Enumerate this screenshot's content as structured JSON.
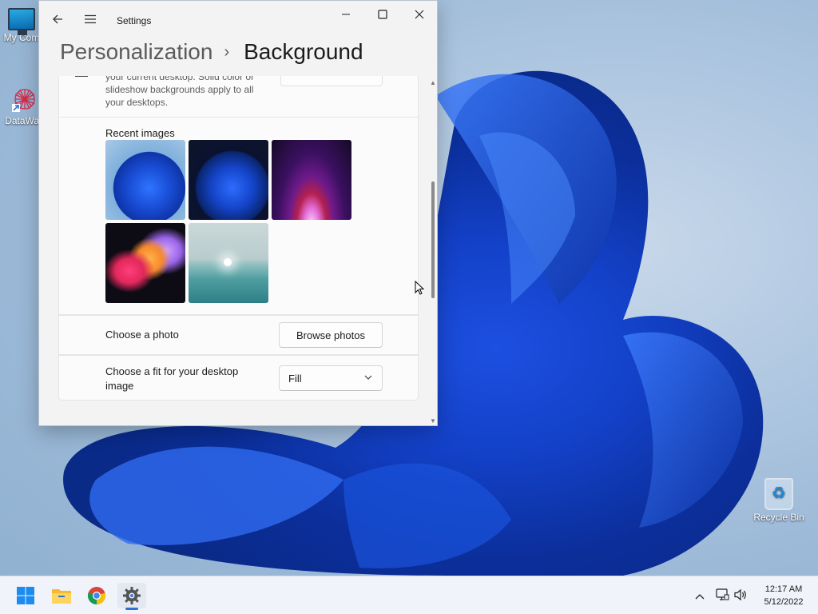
{
  "desktop": {
    "icons": [
      {
        "label": "My Com"
      },
      {
        "label": "DataWag"
      },
      {
        "label": "Recycle Bin"
      }
    ]
  },
  "settings_window": {
    "app_title": "Settings",
    "breadcrumb": {
      "parent": "Personalization",
      "separator": "›",
      "current": "Background"
    },
    "top_description": "your current desktop. Solid color or slideshow backgrounds apply to all your desktops.",
    "recent_images": {
      "label": "Recent images",
      "items": [
        "blue-bloom-light-icon",
        "blue-bloom-dark-icon",
        "purple-glow-icon",
        "colorful-ribbon-icon",
        "lake-sunrise-icon"
      ]
    },
    "choose_photo": {
      "label": "Choose a photo",
      "button": "Browse photos"
    },
    "choose_fit": {
      "label": "Choose a fit for your desktop image",
      "selected": "Fill"
    }
  },
  "taskbar": {
    "apps": [
      "windows-start-icon",
      "file-explorer-icon",
      "chrome-icon",
      "settings-gear-icon"
    ],
    "active_app": "settings-gear-icon",
    "clock": {
      "time": "12:17 AM",
      "date": "5/12/2022"
    }
  },
  "colors": {
    "accent": "#2d6fd8",
    "window_bg": "#f3f3f3",
    "card_bg": "#fbfbfb"
  }
}
